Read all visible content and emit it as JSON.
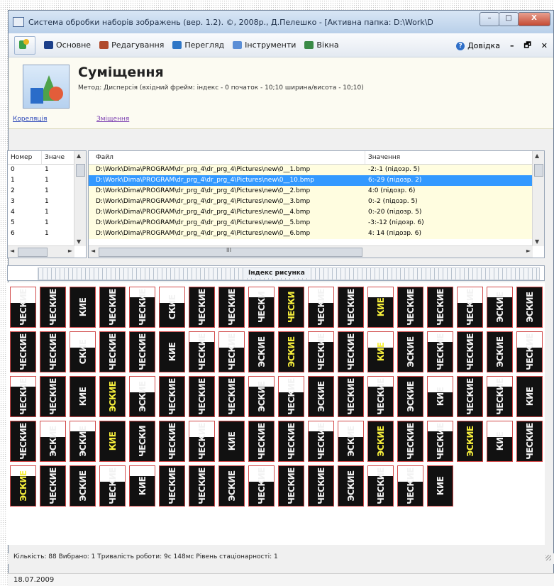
{
  "window": {
    "title": "Система обробки наборів зображень (вер. 1.2). ©, 2008р., Д.Пелешко - [Активна папка: D:\\Work\\Dima\\PRO...",
    "controls": {
      "minimize": "–",
      "maximize": "□",
      "close": "X"
    }
  },
  "menu": {
    "items": [
      {
        "label": "Основне",
        "icon": "monitor-icon",
        "color": "#1c3f8a"
      },
      {
        "label": "Редагування",
        "icon": "edit-icon",
        "color": "#b04a2c"
      },
      {
        "label": "Перегляд",
        "icon": "view-icon",
        "color": "#2f76c6"
      },
      {
        "label": "Інструменти",
        "icon": "tools-icon",
        "color": "#5b8ed6"
      },
      {
        "label": "Вікна",
        "icon": "windows-icon",
        "color": "#3a8a46"
      }
    ],
    "help_label": "Довідка",
    "mdi_min": "–",
    "mdi_restore": "🗗",
    "mdi_close": "✕"
  },
  "header": {
    "title": "Суміщення",
    "subtitle": "Метод: Дисперсія (вхідний фрейм: індекс - 0   початок - 10;10   ширина/висота - 10;10)",
    "link_correlation": "Кореляція",
    "link_shift": "Зміщення"
  },
  "left_grid": {
    "headers": [
      "Номер",
      "Значе"
    ],
    "rows": [
      [
        "0",
        "1"
      ],
      [
        "1",
        "1"
      ],
      [
        "2",
        "1"
      ],
      [
        "3",
        "1"
      ],
      [
        "4",
        "1"
      ],
      [
        "5",
        "1"
      ],
      [
        "6",
        "1"
      ]
    ]
  },
  "right_grid": {
    "headers": [
      "Файл",
      "Значення"
    ],
    "selected_index": 1,
    "rows": [
      [
        "D:\\Work\\Dima\\PROGRAM\\dr_prg_4\\dr_prg_4\\Pictures\\new\\0__1.bmp",
        "-2:-1 (підозр. 5)"
      ],
      [
        "D:\\Work\\Dima\\PROGRAM\\dr_prg_4\\dr_prg_4\\Pictures\\new\\0__10.bmp",
        "6:-29 (підозр. 2)"
      ],
      [
        "D:\\Work\\Dima\\PROGRAM\\dr_prg_4\\dr_prg_4\\Pictures\\new\\0__2.bmp",
        "4:0 (підозр. 6)"
      ],
      [
        "D:\\Work\\Dima\\PROGRAM\\dr_prg_4\\dr_prg_4\\Pictures\\new\\0__3.bmp",
        "0:-2 (підозр. 5)"
      ],
      [
        "D:\\Work\\Dima\\PROGRAM\\dr_prg_4\\dr_prg_4\\Pictures\\new\\0__4.bmp",
        "0:-20 (підозр. 5)"
      ],
      [
        "D:\\Work\\Dima\\PROGRAM\\dr_prg_4\\dr_prg_4\\Pictures\\new\\0__5.bmp",
        "-3:-12 (підозр. 6)"
      ],
      [
        "D:\\Work\\Dima\\PROGRAM\\dr_prg_4\\dr_prg_4\\Pictures\\new\\0__6.bmp",
        "4: 14 (підозр. 6)"
      ]
    ],
    "hscroll_grip": "III"
  },
  "ruler": {
    "label": "Індекс рисунка"
  },
  "thumbnails": {
    "texts": [
      "ЧЕСКИЕ",
      "ЧЕСКИЕ",
      "КИЕ",
      "ЧЕСКИЕ",
      "ЧЕСКИЕ",
      "СКИЕ",
      "ЧЕСКИЕ",
      "ЧЕСКИЕ",
      "ЧЕСКИ",
      "ЧЕСКИ",
      "ЧЕСКИЕ",
      "ЧЕСКИЕ",
      "КИЕ",
      "ЧЕСКИЕ",
      "ЧЕСКИЕ",
      "ЧЕСКИЕ",
      "ЭСКИЕ",
      "ЭСКИЕ",
      "ЧЕСКИЕ",
      "ЧЕСКИЕ",
      "СКИЕ",
      "ЧЕСКИЕ",
      "ЧЕСКИЕ",
      "КИЕ",
      "ЧЕСКИЕ",
      "ЧЕСКИЕ",
      "ЭСКИЕ",
      "ЭСКИЕ",
      "ЧЕСКИЕ",
      "ЧЕСКИЕ",
      "КИЕ",
      "ЭСКИЕ",
      "ЧЕСКИЕ",
      "ЧЕСКИЕ",
      "ЭСКИЕ",
      "ЧЕСКИЕ",
      "ЧЕСКИЕ",
      "ЧЕСКИЕ",
      "КИЕ",
      "ЭСКИЕ",
      "ЭСКИЕ",
      "ЧЕСКИЕ",
      "ЧЕСКИЕ",
      "ЧЕСКИЕ",
      "ЭСКИЕ",
      "ЧЕСКИЕ",
      "ЭСКИЕ",
      "ЧЕСКИЕ",
      "ЧЕСКИЕ",
      "ЭСКИЕ",
      "КИЕ",
      "ЧЕСКИЕ",
      "ЧЕСКИЕ",
      "КИЕ",
      "ЧЕСКИЕ",
      "ЭСКИЕ",
      "ЭСКИЕ",
      "КИЕ",
      "ЧЕСКИ",
      "ЧЕСКИЕ",
      "ЧЕСКИЕ",
      "КИЕ",
      "ЧЕСКИЕ",
      "ЧЕСКИЕ",
      "ЧЕСКИЕ",
      "ЭСКИЕ",
      "ЭСКИЕ",
      "ЧЕСКИЕ",
      "ЧЕСКИЕ",
      "ЭСКИЕ",
      "КИЕ",
      "ЧЕСКИЕ",
      "ЭСКИЕ",
      "ЧЕСКИЕ",
      "ЭСКИЕ",
      "ЧЕСКИЕ",
      "КИЕ",
      "ЧЕСКИЕ",
      "ЧЕСКИЕ",
      "ЭСКИЕ",
      "ЧЕСКИЕ",
      "ЧЕСКИЕ",
      "ЧЕСКИЕ",
      "ЭСКИЕ",
      "ЧЕСКИЕ",
      "ЧЕСКИЕ",
      "КИЕ"
    ]
  },
  "status": {
    "text": "Кількість: 88   Вибрано: 1   Тривалість роботи: 9с 148мс   Рівень стаціонарності: 1"
  },
  "footer": {
    "date": "18.07.2009"
  }
}
